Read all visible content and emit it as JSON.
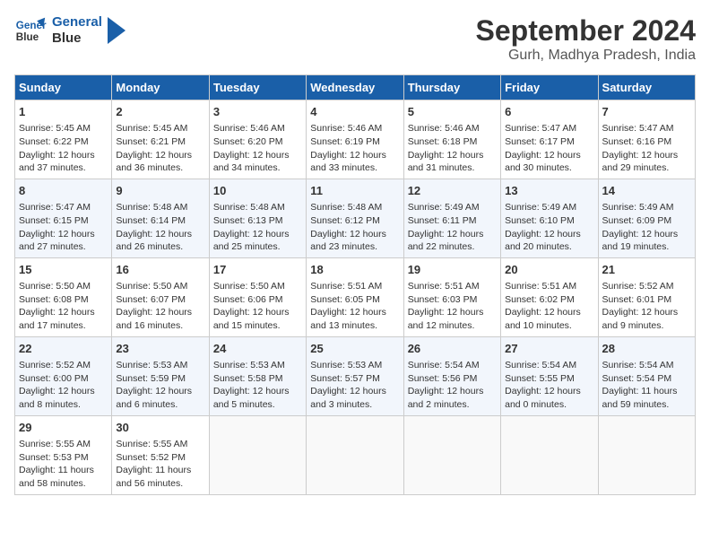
{
  "header": {
    "logo_line1": "General",
    "logo_line2": "Blue",
    "month": "September 2024",
    "location": "Gurh, Madhya Pradesh, India"
  },
  "days_of_week": [
    "Sunday",
    "Monday",
    "Tuesday",
    "Wednesday",
    "Thursday",
    "Friday",
    "Saturday"
  ],
  "weeks": [
    [
      {
        "day": "1",
        "sunrise": "5:45 AM",
        "sunset": "6:22 PM",
        "daylight": "12 hours and 37 minutes."
      },
      {
        "day": "2",
        "sunrise": "5:45 AM",
        "sunset": "6:21 PM",
        "daylight": "12 hours and 36 minutes."
      },
      {
        "day": "3",
        "sunrise": "5:46 AM",
        "sunset": "6:20 PM",
        "daylight": "12 hours and 34 minutes."
      },
      {
        "day": "4",
        "sunrise": "5:46 AM",
        "sunset": "6:19 PM",
        "daylight": "12 hours and 33 minutes."
      },
      {
        "day": "5",
        "sunrise": "5:46 AM",
        "sunset": "6:18 PM",
        "daylight": "12 hours and 31 minutes."
      },
      {
        "day": "6",
        "sunrise": "5:47 AM",
        "sunset": "6:17 PM",
        "daylight": "12 hours and 30 minutes."
      },
      {
        "day": "7",
        "sunrise": "5:47 AM",
        "sunset": "6:16 PM",
        "daylight": "12 hours and 29 minutes."
      }
    ],
    [
      {
        "day": "8",
        "sunrise": "5:47 AM",
        "sunset": "6:15 PM",
        "daylight": "12 hours and 27 minutes."
      },
      {
        "day": "9",
        "sunrise": "5:48 AM",
        "sunset": "6:14 PM",
        "daylight": "12 hours and 26 minutes."
      },
      {
        "day": "10",
        "sunrise": "5:48 AM",
        "sunset": "6:13 PM",
        "daylight": "12 hours and 25 minutes."
      },
      {
        "day": "11",
        "sunrise": "5:48 AM",
        "sunset": "6:12 PM",
        "daylight": "12 hours and 23 minutes."
      },
      {
        "day": "12",
        "sunrise": "5:49 AM",
        "sunset": "6:11 PM",
        "daylight": "12 hours and 22 minutes."
      },
      {
        "day": "13",
        "sunrise": "5:49 AM",
        "sunset": "6:10 PM",
        "daylight": "12 hours and 20 minutes."
      },
      {
        "day": "14",
        "sunrise": "5:49 AM",
        "sunset": "6:09 PM",
        "daylight": "12 hours and 19 minutes."
      }
    ],
    [
      {
        "day": "15",
        "sunrise": "5:50 AM",
        "sunset": "6:08 PM",
        "daylight": "12 hours and 17 minutes."
      },
      {
        "day": "16",
        "sunrise": "5:50 AM",
        "sunset": "6:07 PM",
        "daylight": "12 hours and 16 minutes."
      },
      {
        "day": "17",
        "sunrise": "5:50 AM",
        "sunset": "6:06 PM",
        "daylight": "12 hours and 15 minutes."
      },
      {
        "day": "18",
        "sunrise": "5:51 AM",
        "sunset": "6:05 PM",
        "daylight": "12 hours and 13 minutes."
      },
      {
        "day": "19",
        "sunrise": "5:51 AM",
        "sunset": "6:03 PM",
        "daylight": "12 hours and 12 minutes."
      },
      {
        "day": "20",
        "sunrise": "5:51 AM",
        "sunset": "6:02 PM",
        "daylight": "12 hours and 10 minutes."
      },
      {
        "day": "21",
        "sunrise": "5:52 AM",
        "sunset": "6:01 PM",
        "daylight": "12 hours and 9 minutes."
      }
    ],
    [
      {
        "day": "22",
        "sunrise": "5:52 AM",
        "sunset": "6:00 PM",
        "daylight": "12 hours and 8 minutes."
      },
      {
        "day": "23",
        "sunrise": "5:53 AM",
        "sunset": "5:59 PM",
        "daylight": "12 hours and 6 minutes."
      },
      {
        "day": "24",
        "sunrise": "5:53 AM",
        "sunset": "5:58 PM",
        "daylight": "12 hours and 5 minutes."
      },
      {
        "day": "25",
        "sunrise": "5:53 AM",
        "sunset": "5:57 PM",
        "daylight": "12 hours and 3 minutes."
      },
      {
        "day": "26",
        "sunrise": "5:54 AM",
        "sunset": "5:56 PM",
        "daylight": "12 hours and 2 minutes."
      },
      {
        "day": "27",
        "sunrise": "5:54 AM",
        "sunset": "5:55 PM",
        "daylight": "12 hours and 0 minutes."
      },
      {
        "day": "28",
        "sunrise": "5:54 AM",
        "sunset": "5:54 PM",
        "daylight": "11 hours and 59 minutes."
      }
    ],
    [
      {
        "day": "29",
        "sunrise": "5:55 AM",
        "sunset": "5:53 PM",
        "daylight": "11 hours and 58 minutes."
      },
      {
        "day": "30",
        "sunrise": "5:55 AM",
        "sunset": "5:52 PM",
        "daylight": "11 hours and 56 minutes."
      },
      null,
      null,
      null,
      null,
      null
    ]
  ]
}
